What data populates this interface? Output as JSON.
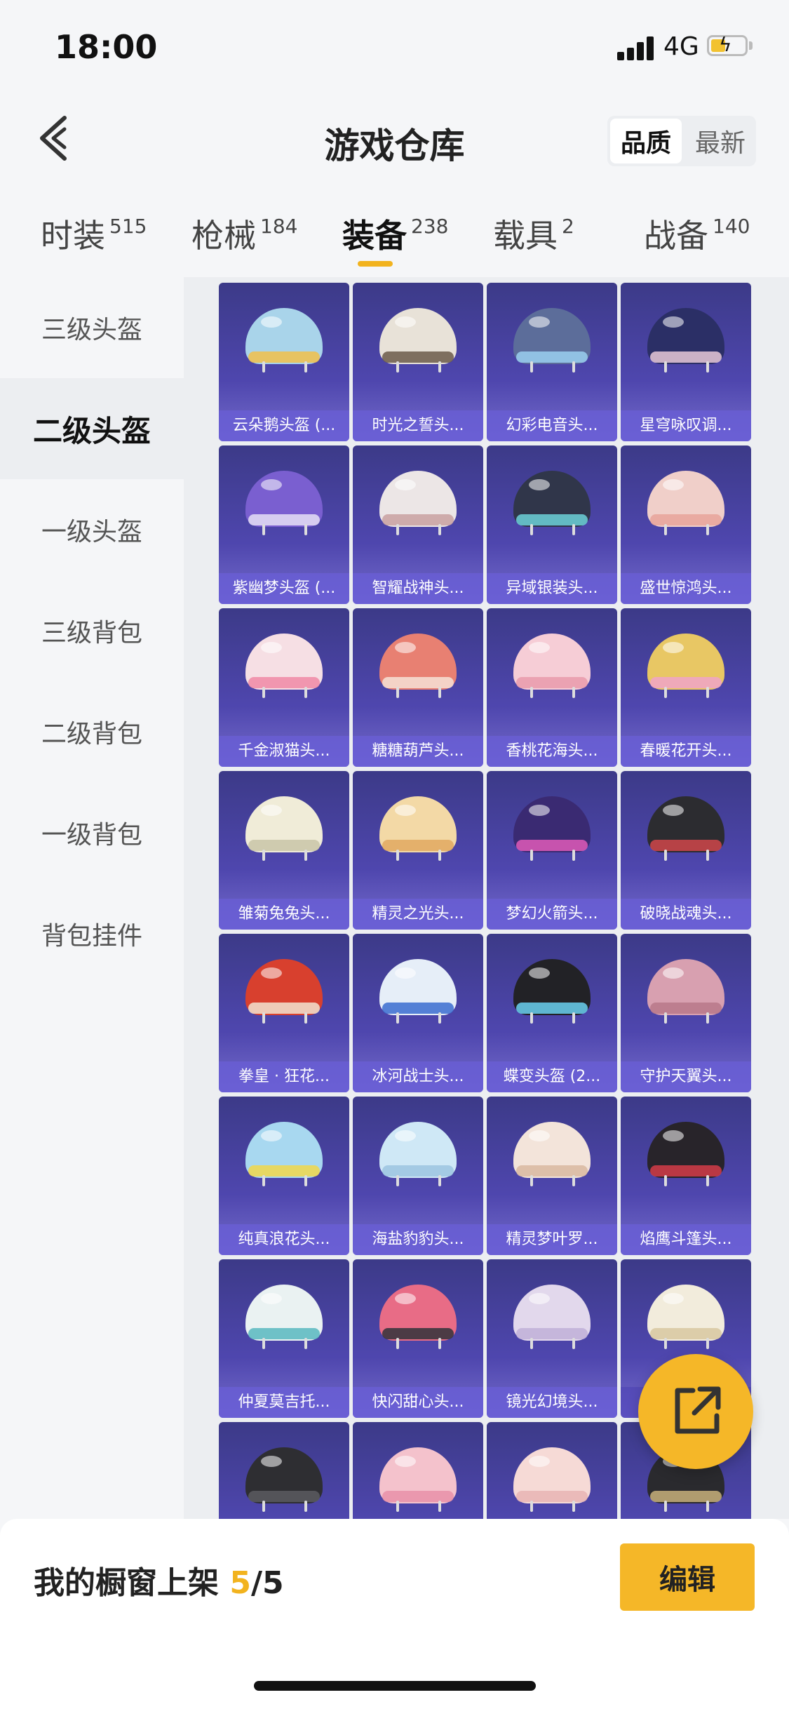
{
  "status_bar": {
    "time": "18:00",
    "network": "4G"
  },
  "header": {
    "title": "游戏仓库",
    "sort_options": [
      "品质",
      "最新"
    ]
  },
  "tabs": [
    {
      "label": "时装",
      "count": "515"
    },
    {
      "label": "枪械",
      "count": "184"
    },
    {
      "label": "装备",
      "count": "238"
    },
    {
      "label": "载具",
      "count": "2"
    },
    {
      "label": "战备",
      "count": "140"
    }
  ],
  "sidebar": {
    "items": [
      {
        "label": "三级头盔"
      },
      {
        "label": "二级头盔"
      },
      {
        "label": "一级头盔"
      },
      {
        "label": "三级背包"
      },
      {
        "label": "二级背包"
      },
      {
        "label": "一级背包"
      },
      {
        "label": "背包挂件"
      }
    ]
  },
  "grid": {
    "items": [
      {
        "name": "云朵鹅头盔 (...",
        "color": "#a9d4ea",
        "accent": "#f2c04a"
      },
      {
        "name": "时光之誓头...",
        "color": "#e8e2d8",
        "accent": "#6b5a4a"
      },
      {
        "name": "幻彩电音头...",
        "color": "#5c6d9a",
        "accent": "#9ad0f0"
      },
      {
        "name": "星穹咏叹调...",
        "color": "#2b2f66",
        "accent": "#e8c9d8"
      },
      {
        "name": "紫幽梦头盔 (...",
        "color": "#7a5fd0",
        "accent": "#e6e0f6"
      },
      {
        "name": "智耀战神头...",
        "color": "#ece6e6",
        "accent": "#c9a0a0"
      },
      {
        "name": "异域银装头...",
        "color": "#30364a",
        "accent": "#6cd1d8"
      },
      {
        "name": "盛世惊鸿头...",
        "color": "#f0cfc9",
        "accent": "#e8a39a"
      },
      {
        "name": "千金淑猫头...",
        "color": "#f6dfe4",
        "accent": "#f08aa6"
      },
      {
        "name": "糖糖葫芦头...",
        "color": "#e88072",
        "accent": "#f6e2d6"
      },
      {
        "name": "香桃花海头...",
        "color": "#f6cdd6",
        "accent": "#e99aac"
      },
      {
        "name": "春暖花开头...",
        "color": "#e8c764",
        "accent": "#f0a3c8"
      },
      {
        "name": "雏菊兔兔头...",
        "color": "#f0ecd8",
        "accent": "#c9c6a8"
      },
      {
        "name": "精灵之光头...",
        "color": "#f3d9a6",
        "accent": "#e0a860"
      },
      {
        "name": "梦幻火箭头...",
        "color": "#3a2a72",
        "accent": "#e05ab8"
      },
      {
        "name": "破晓战魂头...",
        "color": "#2c2c30",
        "accent": "#d0464a"
      },
      {
        "name": "拳皇 · 狂花...",
        "color": "#d8402e",
        "accent": "#f2e4d0"
      },
      {
        "name": "冰河战士头...",
        "color": "#e6eef8",
        "accent": "#3a6cd0"
      },
      {
        "name": "蝶变头盔 (2...",
        "color": "#222226",
        "accent": "#6ad0f0"
      },
      {
        "name": "守护天翼头...",
        "color": "#d8a0b0",
        "accent": "#b8788a"
      },
      {
        "name": "纯真浪花头...",
        "color": "#a8d8f0",
        "accent": "#f2d84a"
      },
      {
        "name": "海盐豹豹头...",
        "color": "#cfe8f6",
        "accent": "#9cc4e0"
      },
      {
        "name": "精灵梦叶罗...",
        "color": "#f3e4da",
        "accent": "#d8b8a0"
      },
      {
        "name": "焰鹰斗篷头...",
        "color": "#28242a",
        "accent": "#d43c48"
      },
      {
        "name": "仲夏莫吉托...",
        "color": "#eaf2f2",
        "accent": "#58b8c0"
      },
      {
        "name": "快闪甜心头...",
        "color": "#e86c86",
        "accent": "#30323a"
      },
      {
        "name": "镜光幻境头...",
        "color": "#e2d8ec",
        "accent": "#c0b0d8"
      },
      {
        "name": "",
        "color": "#f2ecdc",
        "accent": "#d8c8a0"
      },
      {
        "name": "",
        "color": "#2e2e32",
        "accent": "#5a5a60"
      },
      {
        "name": "",
        "color": "#f4c2cc",
        "accent": "#e890a8"
      },
      {
        "name": "",
        "color": "#f6dad6",
        "accent": "#e8b4b4"
      },
      {
        "name": "",
        "color": "#2a2a2e",
        "accent": "#c8b07a"
      }
    ]
  },
  "bottom": {
    "shelf_label": "我的橱窗上架",
    "shelf_count": "5",
    "shelf_total": "/5",
    "edit_label": "编辑"
  },
  "colors": {
    "accent": "#f5b728",
    "card_bg": "#4e46ad"
  }
}
